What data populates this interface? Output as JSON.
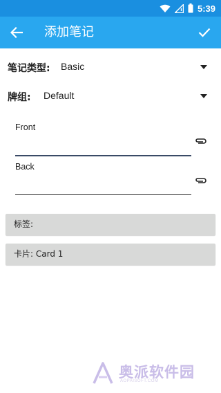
{
  "status_bar": {
    "time": "5:39",
    "icons": [
      "wifi-icon",
      "signal-icon",
      "battery-icon"
    ]
  },
  "toolbar": {
    "back_icon": "arrow-left-icon",
    "title": "添加笔记",
    "confirm_icon": "check-icon"
  },
  "note_type": {
    "label": "笔记类型:",
    "value": "Basic"
  },
  "deck": {
    "label": "牌组:",
    "value": "Default"
  },
  "fields": [
    {
      "label": "Front",
      "value": "",
      "attach_icon": "paperclip-icon"
    },
    {
      "label": "Back",
      "value": "",
      "attach_icon": "paperclip-icon"
    }
  ],
  "tags_button": {
    "label": "标签:"
  },
  "cards_button": {
    "label": "卡片: Card 1"
  },
  "watermark": {
    "text": "奥派软件园",
    "subtext": "AOPAISOFT.COM"
  },
  "colors": {
    "status_bar": "#1a8fe0",
    "toolbar": "#29a7ef",
    "underline_front": "#3a4a66",
    "underline_back": "#333333",
    "button_bg": "#d8d9d8",
    "watermark": "#c9bde8"
  }
}
